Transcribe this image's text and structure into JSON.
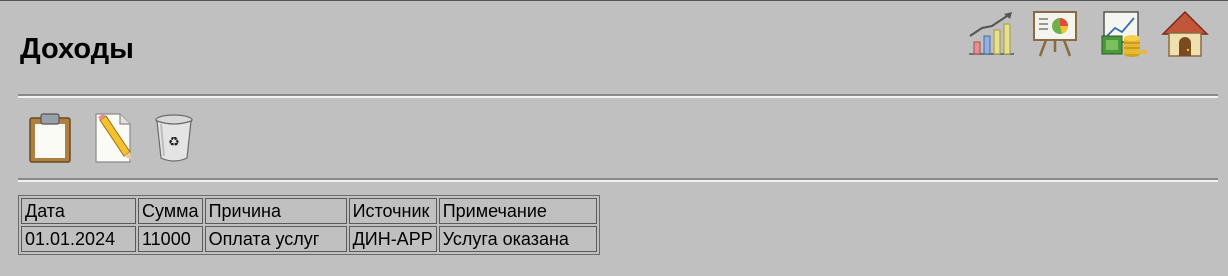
{
  "page": {
    "title": "Доходы"
  },
  "nav_icons": [
    "bar-chart-icon",
    "presentation-pie-chart-icon",
    "money-chart-icon",
    "home-icon"
  ],
  "toolbar_icons": [
    "clipboard-icon",
    "edit-document-icon",
    "trash-icon"
  ],
  "table": {
    "headers": [
      "Дата",
      "Сумма",
      "Причина",
      "Источник",
      "Примечание"
    ],
    "rows": [
      [
        "01.01.2024",
        "11000",
        "Оплата услуг",
        "ДИН-АРР",
        "Услуга оказана"
      ]
    ]
  }
}
